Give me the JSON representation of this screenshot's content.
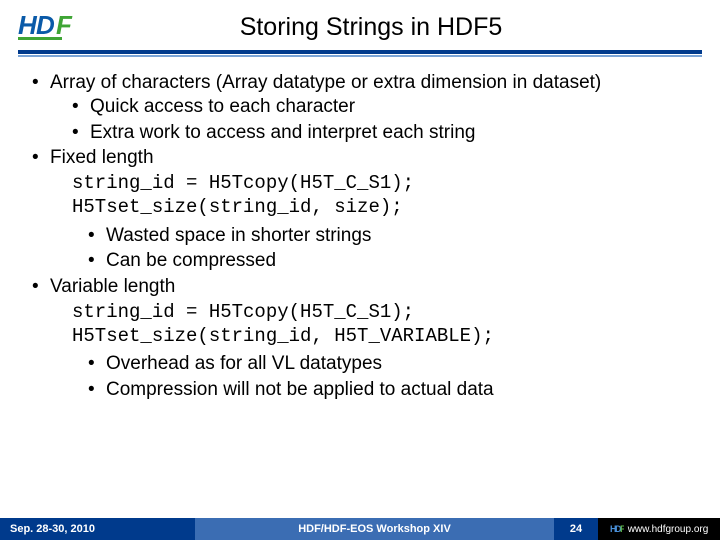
{
  "title": "Storing Strings in HDF5",
  "bullets": {
    "array_chars": "Array of characters (Array datatype or extra dimension in dataset)",
    "quick_access": "Quick access to each character",
    "extra_work": "Extra work to access and interpret each string",
    "fixed_length": "Fixed length",
    "code_fixed": "string_id = H5Tcopy(H5T_C_S1);\nH5Tset_size(string_id, size);",
    "wasted": "Wasted space in shorter strings",
    "compressed": "Can be compressed",
    "var_length": "Variable length",
    "code_var": "string_id = H5Tcopy(H5T_C_S1);\nH5Tset_size(string_id, H5T_VARIABLE);",
    "overhead": "Overhead as for all VL datatypes",
    "no_compress": "Compression will not be applied to actual data"
  },
  "footer": {
    "date": "Sep. 28-30, 2010",
    "event": "HDF/HDF-EOS Workshop XIV",
    "page": "24",
    "url": "www.hdfgroup.org"
  }
}
